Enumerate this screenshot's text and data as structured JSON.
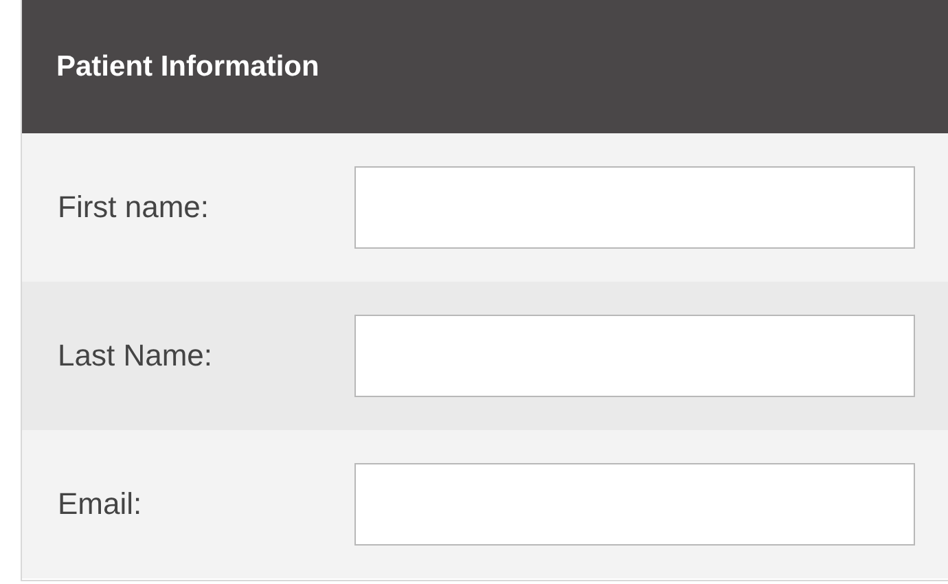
{
  "panel": {
    "title": "Patient Information"
  },
  "fields": [
    {
      "label": "First name:"
    },
    {
      "label": "Last Name:"
    },
    {
      "label": "Email:"
    }
  ]
}
